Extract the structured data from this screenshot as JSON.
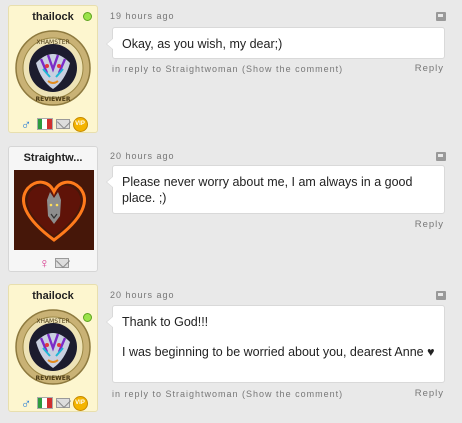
{
  "comments": [
    {
      "username": "thailock",
      "online": true,
      "time": "19 hours ago",
      "text": [
        "Okay, as you wish, my dear;)"
      ],
      "reply_to": "in reply to Straightwoman (Show the comment)",
      "reply_label": "Reply",
      "badge_text": {
        "top": "XHAMSTER",
        "bottom": "REVIEWER"
      },
      "icons": [
        "male-icon",
        "italy-flag-icon",
        "mail-icon",
        "vip-icon"
      ]
    },
    {
      "username": "Straightw...",
      "online": false,
      "time": "20 hours ago",
      "text": [
        "Please never worry about me, I am always in a good place. ;)"
      ],
      "reply_label": "Reply",
      "icons": [
        "female-icon",
        "mail-icon"
      ]
    },
    {
      "username": "thailock",
      "online": true,
      "time": "20 hours ago",
      "text": [
        "Thank to God!!!",
        "I was beginning to be worried about you, dearest Anne ♥"
      ],
      "reply_to": "in reply to Straightwoman (Show the comment)",
      "reply_label": "Reply",
      "badge_text": {
        "top": "XHAMSTER",
        "bottom": "REVIEWER"
      },
      "icons": [
        "male-icon",
        "italy-flag-icon",
        "mail-icon",
        "vip-icon"
      ]
    }
  ],
  "colors": {
    "background": "#e9e9e9",
    "user_card_yellow": "#fdf6cf",
    "online_dot": "#9be34a",
    "male": "#2a7ed6",
    "female": "#d6338a"
  },
  "glyphs": {
    "male": "♂",
    "female": "♀",
    "vip": "VIP"
  }
}
